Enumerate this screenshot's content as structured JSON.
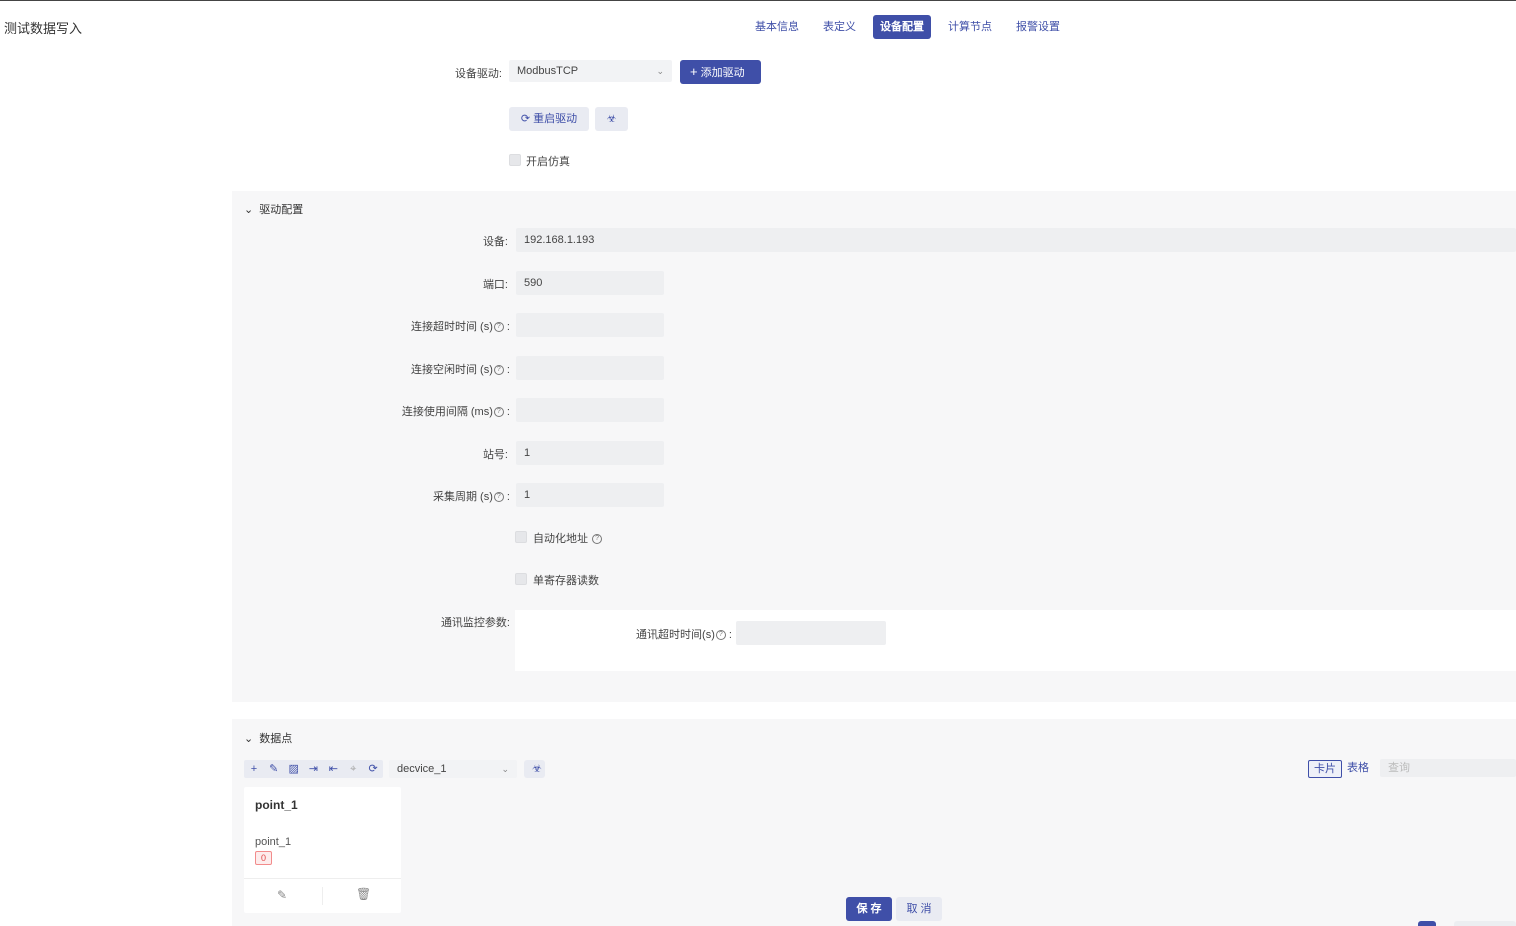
{
  "page": {
    "title": "测试数据写入"
  },
  "tabs": [
    {
      "label": "基本信息",
      "active": false
    },
    {
      "label": "表定义",
      "active": false
    },
    {
      "label": "设备配置",
      "active": true
    },
    {
      "label": "计算节点",
      "active": false
    },
    {
      "label": "报警设置",
      "active": false
    }
  ],
  "driver": {
    "label": "设备驱动:",
    "selected": "ModbusTCP",
    "add_button": "添加驱动",
    "restart_button": "重启驱动",
    "simulate_label": "开启仿真"
  },
  "driver_config": {
    "section_title": "驱动配置",
    "device_label": "设备:",
    "device_value": "192.168.1.193",
    "port_label": "端口:",
    "port_value": "590",
    "connect_timeout_label": "连接超时时间 (s)",
    "connect_idle_label": "连接空闲时间 (s)",
    "connect_interval_label": "连接使用间隔 (ms)",
    "station_label": "站号:",
    "station_value": "1",
    "collect_cycle_label": "采集周期 (s)",
    "collect_cycle_value": "1",
    "auto_address_label": "自动化地址",
    "single_register_label": "单寄存器读数",
    "comm_monitor_label": "通讯监控参数:",
    "comm_timeout_label": "通讯超时时间(s)"
  },
  "data_points": {
    "section_title": "数据点",
    "device_select": "decvice_1",
    "view_card": "卡片",
    "view_table": "表格",
    "search_placeholder": "查询",
    "cards": [
      {
        "title": "point_1",
        "name": "point_1",
        "value": "0"
      }
    ]
  },
  "footer": {
    "save": "保 存",
    "cancel": "取 消"
  }
}
